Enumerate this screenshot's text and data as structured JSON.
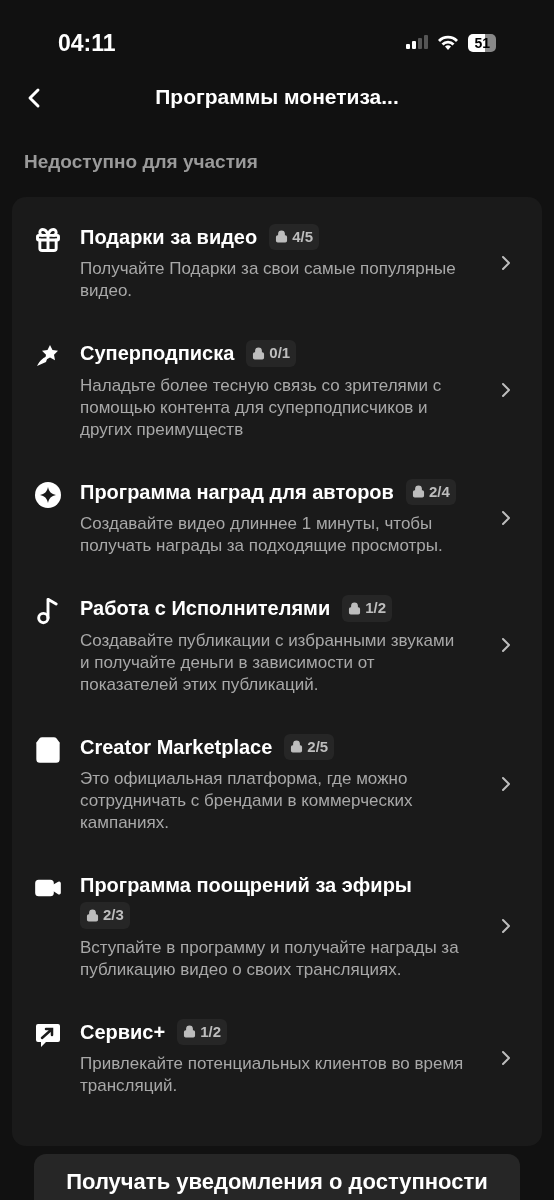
{
  "status_bar": {
    "time": "04:11",
    "battery": "51"
  },
  "header": {
    "title": "Программы монетиза..."
  },
  "section_title": "Недоступно для участия",
  "programs": [
    {
      "kind": "gift",
      "title": "Подарки за видео",
      "badge": "4/5",
      "description": "Получайте Подарки за свои самые популярные видео."
    },
    {
      "kind": "star",
      "title": "Суперподписка",
      "badge": "0/1",
      "description": "Наладьте более тесную связь со зрителями с помощью контента для суперподписчиков и других преимуществ"
    },
    {
      "kind": "sparkle",
      "title": "Программа наград для авторов",
      "badge": "2/4",
      "description": "Создавайте видео длиннее 1 минуты, чтобы получать награды за подходящие просмотры."
    },
    {
      "kind": "music",
      "title": "Работа с Исполнителями",
      "badge": "1/2",
      "description": "Создавайте публикации с избранными звуками и получайте деньги в зависимости от показателей этих публикаций."
    },
    {
      "kind": "bag",
      "title": "Creator Marketplace",
      "badge": "2/5",
      "description": "Это официальная платформа, где можно сотрудничать с брендами в коммерческих кампаниях."
    },
    {
      "kind": "video",
      "title": "Программа поощрений за эфиры",
      "badge": "2/3",
      "description": "Вступайте в программу и получайте награды за публикацию видео о своих трансляциях."
    },
    {
      "kind": "chat",
      "title": "Сервис+",
      "badge": "1/2",
      "description": "Привлекайте потенциальных клиентов во время трансляций."
    }
  ],
  "notify_button": "Получать уведомления о доступности"
}
